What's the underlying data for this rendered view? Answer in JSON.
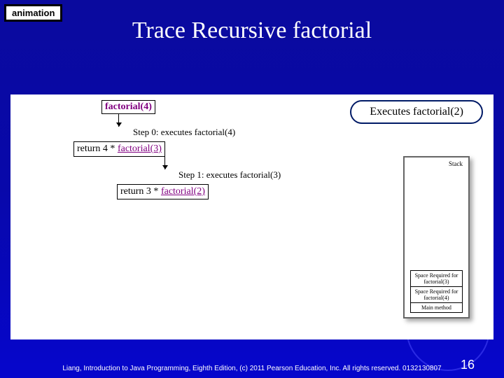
{
  "badge": "animation",
  "title": "Trace Recursive factorial",
  "callout": "Executes factorial(2)",
  "diagram": {
    "call0": "factorial(4)",
    "step0": "Step 0: executes factorial(4)",
    "row1_prefix": "return 4 * ",
    "row1_link": "factorial(3)",
    "step1": "Step 1: executes factorial(3)",
    "row2_prefix": "return 3 * ",
    "row2_link": "factorial(2)"
  },
  "stack": {
    "label": "Stack",
    "frames": [
      "Space Required for factorial(3)",
      "Space Required for factorial(4)",
      "Main method"
    ]
  },
  "footer": "Liang, Introduction to Java Programming, Eighth Edition, (c) 2011 Pearson Education, Inc. All rights reserved. 0132130807",
  "page": "16"
}
